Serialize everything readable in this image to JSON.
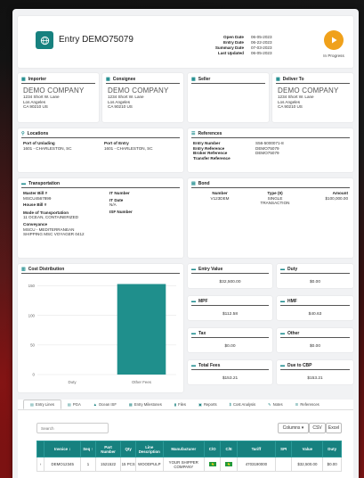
{
  "header": {
    "title": "Entry DEMO75079",
    "dates": [
      {
        "label": "Open Date",
        "value": "06-05-2023"
      },
      {
        "label": "Entry Date",
        "value": "06-22-2023"
      },
      {
        "label": "Summary Date",
        "value": "07-03-2023"
      },
      {
        "label": "Last Updated",
        "value": "06-05-2023"
      }
    ],
    "status": "In Progress",
    "status_color": "#f0a11b",
    "brand_color": "#17817f"
  },
  "parties": [
    {
      "title": "Importer",
      "name": "DEMO COMPANY",
      "address": [
        "1234 Short W. Lane",
        "Los Angeles",
        "CA 90210 US"
      ]
    },
    {
      "title": "Consignee",
      "name": "DEMO COMPANY",
      "address": [
        "1234 Short W. Lane",
        "Los Angeles",
        "CA 90210 US"
      ]
    },
    {
      "title": "Seller",
      "name": "",
      "address": []
    },
    {
      "title": "Deliver To",
      "name": "DEMO COMPANY",
      "address": [
        "1234 Short W. Lane",
        "Los Angeles",
        "CA 90210 US"
      ]
    }
  ],
  "locations": {
    "title": "Locations",
    "unlading_label": "Port of Unlading",
    "unlading_value": "1601 - CHARLESTON, SC",
    "entry_label": "Port of Entry",
    "entry_value": "1601 - CHARLESTON, SC"
  },
  "references": {
    "title": "References",
    "rows": [
      {
        "label": "Entry Number",
        "value": "S56-5000071-8"
      },
      {
        "label": "Entry Reference",
        "value": "DEMO75079"
      },
      {
        "label": "Broker Reference",
        "value": "DEMO75079"
      },
      {
        "label": "Transfer Reference",
        "value": ""
      }
    ]
  },
  "transportation": {
    "title": "Transportation",
    "master_bill_label": "Master Bill #",
    "master_bill_value": "MSCU4567899",
    "house_bill_label": "House Bill #",
    "it_number_label": "IT Number",
    "it_date_label": "IT Date",
    "it_date_value": "N/A",
    "mode_label": "Mode of Transportation",
    "mode_value": "11 OCEAN, CONTAINERIZED",
    "isf_label": "ISF Number",
    "conveyance_label": "Conveyance",
    "conveyance_lines": [
      "MSCU - MEDITERRANEAN",
      "SHIPPING MSC VOYAGER 0412"
    ]
  },
  "bond": {
    "title": "Bond",
    "number_label": "Number",
    "number_value": "V123DEM",
    "type_label": "Type (9)",
    "type_value": [
      "SINGLE",
      "TRANSACTION"
    ],
    "amount_label": "Amount",
    "amount_value": "$100,000.00"
  },
  "cost": {
    "title": "Cost Distribution"
  },
  "chart_data": {
    "type": "bar",
    "categories": [
      "Duty",
      "Other Fees"
    ],
    "values": [
      0,
      153.21
    ],
    "ylim": [
      0,
      160
    ],
    "yticks": [
      0,
      50,
      100,
      150
    ],
    "bar_color": "#1f8f8c",
    "grid": true
  },
  "fees": [
    {
      "label": "Entry Value",
      "value": "$32,500.00"
    },
    {
      "label": "Duty",
      "value": "$0.00"
    },
    {
      "label": "MPF",
      "value": "$112.58"
    },
    {
      "label": "HMF",
      "value": "$40.63"
    },
    {
      "label": "Tax",
      "value": "$0.00"
    },
    {
      "label": "Other",
      "value": "$0.00"
    },
    {
      "label": "Total Fees",
      "value": "$153.21"
    },
    {
      "label": "Due to CBP",
      "value": "$153.21"
    }
  ],
  "tabs": [
    {
      "label": "Entry Lines",
      "icon": "list-icon"
    },
    {
      "label": "PGA",
      "icon": "document-icon"
    },
    {
      "label": "Ocean ISF",
      "icon": "ship-icon"
    },
    {
      "label": "Entry Milestones",
      "icon": "milestone-icon"
    },
    {
      "label": "Files",
      "icon": "file-icon"
    },
    {
      "label": "Reports",
      "icon": "report-icon"
    },
    {
      "label": "Cost Analysis",
      "icon": "dollar-icon"
    },
    {
      "label": "Notes",
      "icon": "note-icon"
    },
    {
      "label": "References",
      "icon": "references-icon"
    }
  ],
  "toolbar": {
    "search_placeholder": "Search",
    "columns_label": "Columns ▾",
    "csv_label": "CSV",
    "excel_label": "Excel"
  },
  "table": {
    "columns": [
      "Invoice",
      "Seq",
      "Part Number",
      "Qty",
      "Line Description",
      "Manufacturer",
      "C/O",
      "C/E",
      "Tariff",
      "SPI",
      "Value",
      "Duty"
    ],
    "sort_columns": [
      "Invoice ↕",
      "Seq ↑"
    ],
    "row": {
      "invoice": "DEMO12345",
      "seq": "1",
      "part": "1521522",
      "qty": "15 PCS",
      "desc": "WOODPULP",
      "manufacturer": "YOUR SHIPPER COMPANY",
      "tariff": "4703190000",
      "spi": "",
      "value": "$32,500.00",
      "duty": "$0.00"
    }
  }
}
